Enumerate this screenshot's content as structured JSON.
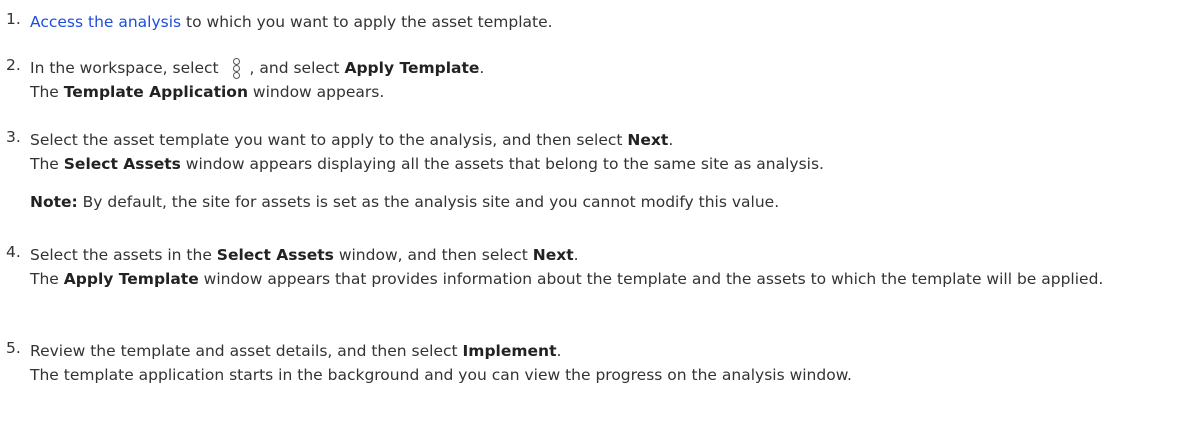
{
  "steps": [
    {
      "num": "1.",
      "link": "Access the analysis",
      "text_after": " to which you want to apply the asset template."
    },
    {
      "num": "2.",
      "pre": "In the workspace, select ",
      "icon": "more-options-icon",
      "mid": ", and select ",
      "bold1": "Apply Template",
      "end": ".",
      "result_pre": "The ",
      "result_bold": "Template Application",
      "result_post": " window appears."
    },
    {
      "num": "3.",
      "pre": "Select the asset template you want to apply to the analysis, and then select ",
      "bold1": "Next",
      "end": ".",
      "result_pre": "The ",
      "result_bold": "Select Assets",
      "result_post": " window appears displaying all the assets that belong to the same site as analysis.",
      "note_label": "Note:",
      "note_text": " By default, the site for assets is set as the analysis site and you cannot modify this value."
    },
    {
      "num": "4.",
      "pre": "Select the assets in the ",
      "bold1": "Select Assets",
      "mid": " window, and then select ",
      "bold2": "Next",
      "end": ".",
      "result_pre": "The ",
      "result_bold": "Apply Template",
      "result_post": " window appears that provides information about the template and the assets to which the template will be applied."
    },
    {
      "num": "5.",
      "pre": "Review the template and asset details, and then select ",
      "bold1": "Implement",
      "end": ".",
      "result_text": "The template application starts in the background and you can view the progress on the analysis window."
    }
  ]
}
